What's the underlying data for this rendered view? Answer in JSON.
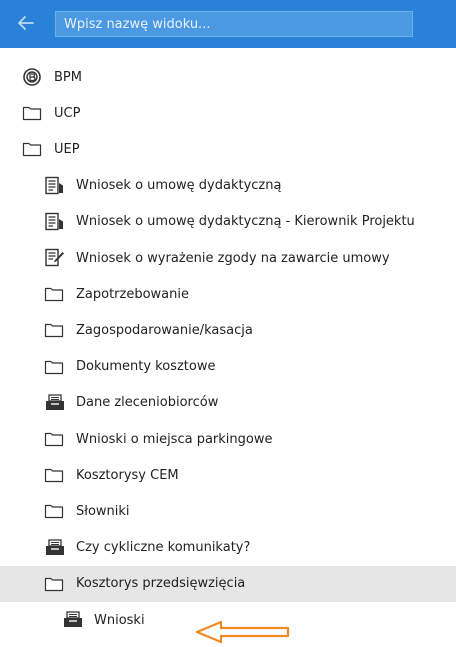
{
  "header": {
    "back_icon": "arrow-left-icon",
    "search_placeholder": "Wpisz nazwę widoku...",
    "search_value": "",
    "bg_color": "#2a82d8"
  },
  "tree": {
    "items": [
      {
        "label": "BPM",
        "icon": "bpm-logo-icon",
        "level": 0
      },
      {
        "label": "UCP",
        "icon": "folder-icon",
        "level": 0
      },
      {
        "label": "UEP",
        "icon": "folder-icon",
        "level": 0
      },
      {
        "label": "Wniosek o umowę dydaktyczną",
        "icon": "document-form-icon",
        "level": 1
      },
      {
        "label": "Wniosek o umowę dydaktyczną - Kierownik Projektu",
        "icon": "document-form-icon",
        "level": 1
      },
      {
        "label": "Wniosek o wyrażenie zgody na zawarcie umowy",
        "icon": "edit-document-icon",
        "level": 1
      },
      {
        "label": "Zapotrzebowanie",
        "icon": "folder-icon",
        "level": 1
      },
      {
        "label": "Zagospodarowanie/kasacja",
        "icon": "folder-icon",
        "level": 1
      },
      {
        "label": "Dokumenty kosztowe",
        "icon": "folder-icon",
        "level": 1
      },
      {
        "label": "Dane zleceniobiorców",
        "icon": "inbox-tray-icon",
        "level": 1
      },
      {
        "label": "Wnioski o miejsca parkingowe",
        "icon": "folder-icon",
        "level": 1
      },
      {
        "label": "Kosztorysy CEM",
        "icon": "folder-icon",
        "level": 1
      },
      {
        "label": "Słowniki",
        "icon": "folder-icon",
        "level": 1
      },
      {
        "label": "Czy cykliczne komunikaty?",
        "icon": "inbox-tray-icon",
        "level": 1
      },
      {
        "label": "Kosztorys przedsięwzięcia",
        "icon": "folder-icon",
        "level": 1,
        "selected": true
      },
      {
        "label": "Wnioski",
        "icon": "inbox-tray-icon",
        "level": 2
      }
    ]
  },
  "annotation": {
    "icon": "orange-arrow-left-icon",
    "color": "#f08a24"
  }
}
